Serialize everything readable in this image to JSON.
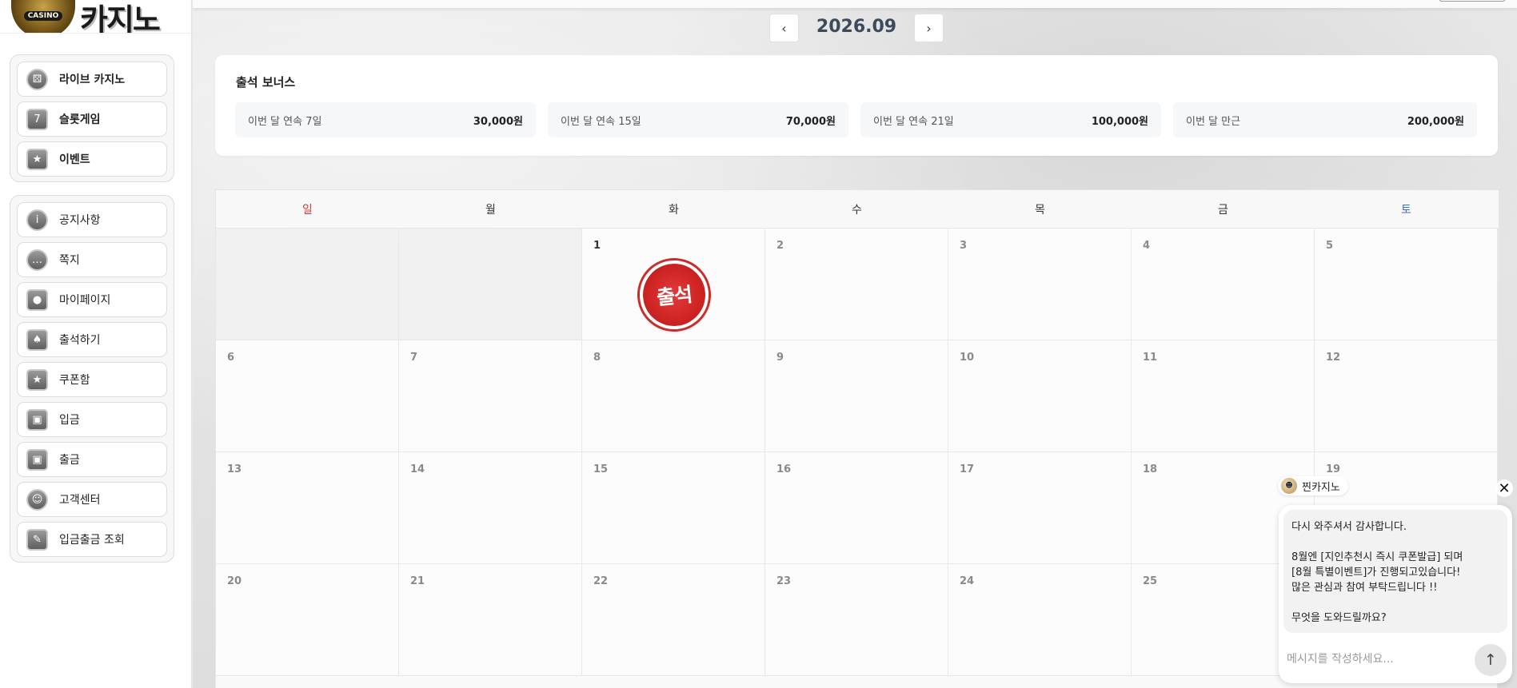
{
  "logo": {
    "badge": "CASINO",
    "text": "카지노"
  },
  "sidebar": {
    "group1": [
      {
        "label": "라이브 카지노",
        "icon": "dice-icon"
      },
      {
        "label": "슬롯게임",
        "icon": "slot-machine-icon"
      },
      {
        "label": "이벤트",
        "icon": "star-icon"
      }
    ],
    "group2": [
      {
        "label": "공지사항",
        "icon": "info-icon"
      },
      {
        "label": "쪽지",
        "icon": "message-icon"
      },
      {
        "label": "마이페이지",
        "icon": "user-icon"
      },
      {
        "label": "출석하기",
        "icon": "calendar-icon"
      },
      {
        "label": "쿠폰함",
        "icon": "star-icon"
      },
      {
        "label": "입금",
        "icon": "wallet-icon"
      },
      {
        "label": "출금",
        "icon": "wallet-icon"
      },
      {
        "label": "고객센터",
        "icon": "headset-icon"
      },
      {
        "label": "입금출금 조회",
        "icon": "receipt-icon"
      }
    ]
  },
  "calendar_nav": {
    "prev": "‹",
    "month": "2026.09",
    "next": "›"
  },
  "bonus": {
    "title": "출석 보너스",
    "items": [
      {
        "label": "이번 달 연속 7일",
        "amount": "30,000원"
      },
      {
        "label": "이번 달 연속 15일",
        "amount": "70,000원"
      },
      {
        "label": "이번 달 연속 21일",
        "amount": "100,000원"
      },
      {
        "label": "이번 달 만근",
        "amount": "200,000원"
      }
    ]
  },
  "calendar": {
    "weekdays": [
      "일",
      "월",
      "화",
      "수",
      "목",
      "금",
      "토"
    ],
    "first_weekday_index": 2,
    "days_visible": 25,
    "stamp_day": 1,
    "stamp_text": "출석"
  },
  "chat": {
    "agent_name": "찐카지노",
    "close": "✕",
    "message": "다시 와주셔서 감사합니다.\n\n8월엔 [지인추천시 즉시 쿠폰발급] 되며\n[8월 특별이벤트]가 진행되고있습니다!\n많은 관심과 참여 부탁드립니다 !!\n\n무엇을 도와드릴까요?",
    "input_placeholder": "메시지를 작성하세요...",
    "send": "↑"
  },
  "colors": {
    "sunday": "#d03a3a",
    "saturday": "#3a6fd0",
    "stamp": "#d02525"
  }
}
